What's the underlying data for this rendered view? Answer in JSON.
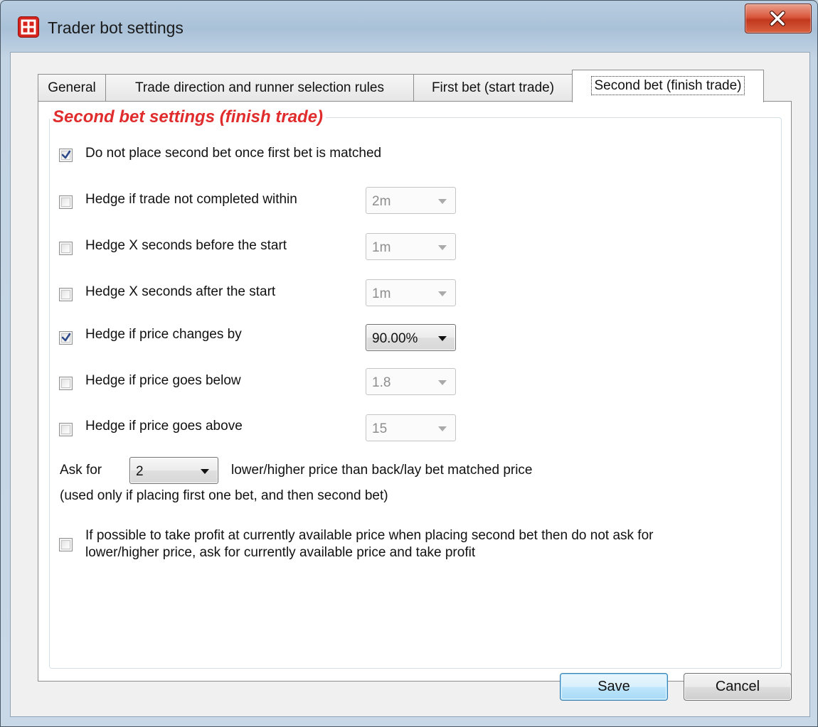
{
  "window": {
    "title": "Trader bot settings",
    "icon": "app-grid-icon",
    "close_icon": "close-icon",
    "close_color": "#c2381e"
  },
  "tabs": [
    {
      "label": "General",
      "active": false
    },
    {
      "label": "Trade direction and runner selection rules",
      "active": false
    },
    {
      "label": "First bet (start trade)",
      "active": false
    },
    {
      "label": "Second bet (finish trade)",
      "active": true
    }
  ],
  "group": {
    "title": "Second bet settings (finish trade)",
    "title_color": "#e02c2c"
  },
  "options": {
    "do_not_place": {
      "label": "Do not place second bet once first bet is matched",
      "checked": true
    },
    "hedge_time": {
      "label": "Hedge if trade not completed within",
      "checked": false,
      "value": "2m",
      "enabled": false
    },
    "hedge_before": {
      "label": "Hedge X seconds before the start",
      "checked": false,
      "value": "1m",
      "enabled": false
    },
    "hedge_after": {
      "label": "Hedge X seconds after the start",
      "checked": false,
      "value": "1m",
      "enabled": false
    },
    "hedge_price_change": {
      "label": "Hedge if price changes by",
      "checked": true,
      "value": "90.00%",
      "enabled": true
    },
    "hedge_below": {
      "label": "Hedge if price goes below",
      "checked": false,
      "value": "1.8",
      "enabled": false
    },
    "hedge_above": {
      "label": "Hedge if price goes above",
      "checked": false,
      "value": "15",
      "enabled": false
    }
  },
  "ask": {
    "prefix": "Ask for",
    "value": "2",
    "suffix": "lower/higher price than back/lay bet matched price",
    "note": "(used only if placing first one bet, and then second bet)"
  },
  "take_profit": {
    "checked": false,
    "line1": "If possible to take profit at currently available price when placing second bet then do not ask for",
    "line2": "lower/higher price, ask for currently available price and take profit"
  },
  "buttons": {
    "save": "Save",
    "cancel": "Cancel"
  }
}
